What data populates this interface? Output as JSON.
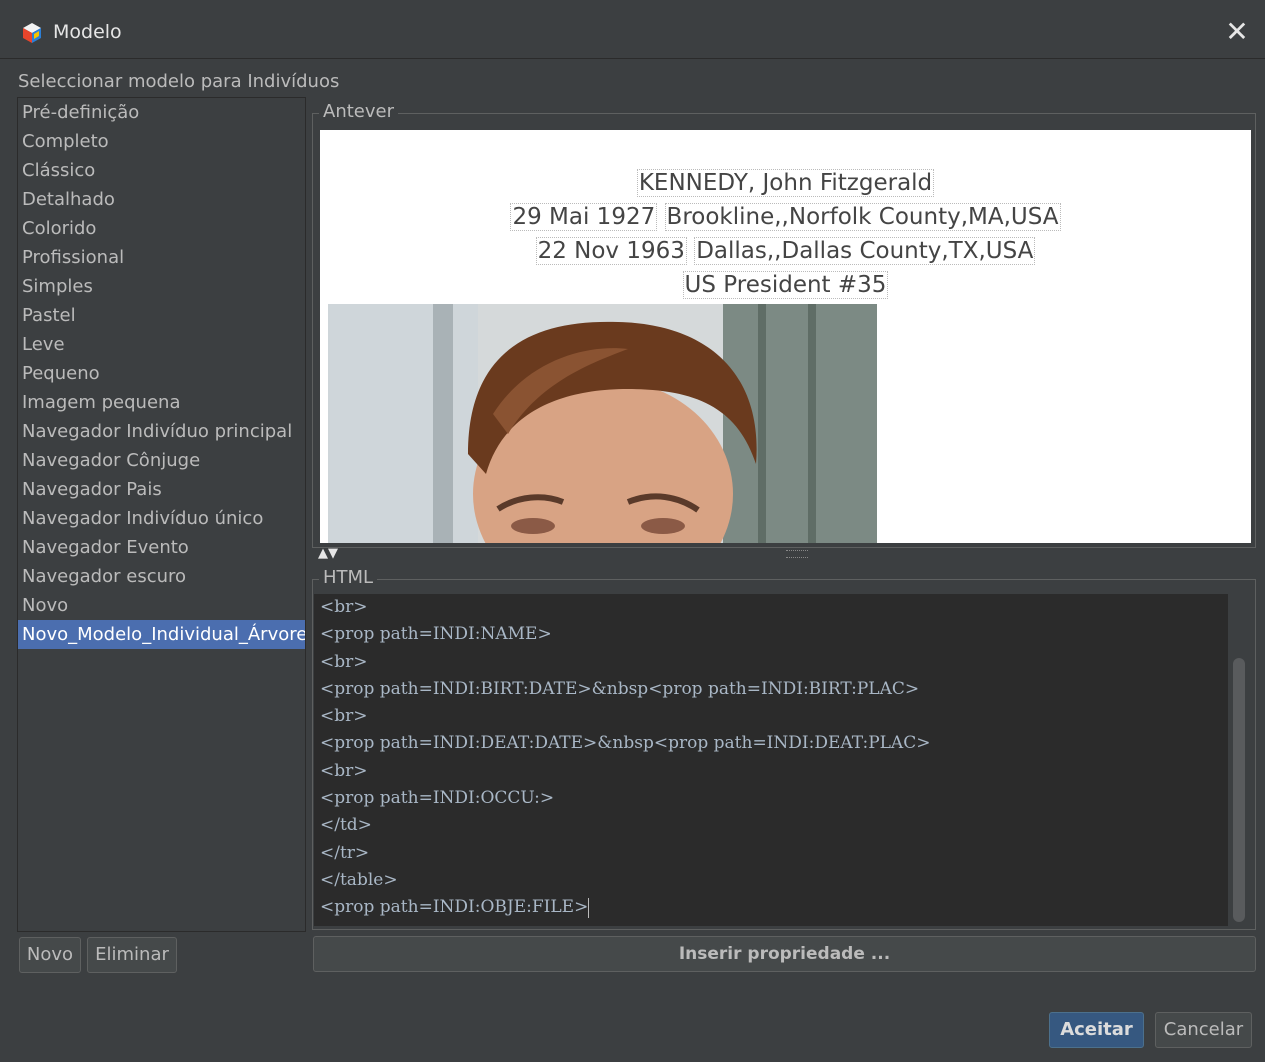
{
  "window": {
    "title": "Modelo",
    "close_label": "✕"
  },
  "select_label": "Seleccionar modelo para Indivíduos",
  "models": [
    "Pré-definição",
    "Completo",
    "Clássico",
    "Detalhado",
    "Colorido",
    "Profissional",
    "Simples",
    "Pastel",
    "Leve",
    "Pequeno",
    "Imagem pequena",
    "Navegador Indivíduo principal",
    "Navegador Cônjuge",
    "Navegador Pais",
    "Navegador Indivíduo único",
    "Navegador Evento",
    "Navegador escuro",
    "Novo",
    "Novo_Modelo_Individual_Árvore"
  ],
  "selected_model": "Novo_Modelo_Individual_Árvore",
  "list_buttons": {
    "new": "Novo",
    "delete": "Eliminar"
  },
  "preview": {
    "title": "Antever",
    "name": "KENNEDY, John Fitzgerald",
    "birth_date": "29 Mai 1927",
    "birth_place": "Brookline,,Norfolk County,MA,USA",
    "death_date": "22 Nov 1963",
    "death_place": "Dallas,,Dallas County,TX,USA",
    "occupation": "US President #35"
  },
  "html_panel": {
    "title": "HTML",
    "lines": [
      "<br>",
      "<prop path=INDI:NAME>",
      "<br>",
      "<prop path=INDI:BIRT:DATE>&nbsp<prop path=INDI:BIRT:PLAC>",
      "<br>",
      "<prop path=INDI:DEAT:DATE>&nbsp<prop path=INDI:DEAT:PLAC>",
      "<br>",
      "<prop path=INDI:OCCU:>",
      "</td>",
      "</tr>",
      "</table>",
      "<prop path=INDI:OBJE:FILE>"
    ]
  },
  "insert_property_label": "Inserir propriedade ...",
  "footer": {
    "accept": "Aceitar",
    "cancel": "Cancelar"
  },
  "colors": {
    "background": "#3c3f41",
    "selection": "#4b6eaf",
    "editor_bg": "#2b2b2b",
    "accent_button": "#365880"
  },
  "icons": {
    "app": "app-cube-icon",
    "close": "close-icon",
    "splitter": "splitter-arrows-icon"
  }
}
